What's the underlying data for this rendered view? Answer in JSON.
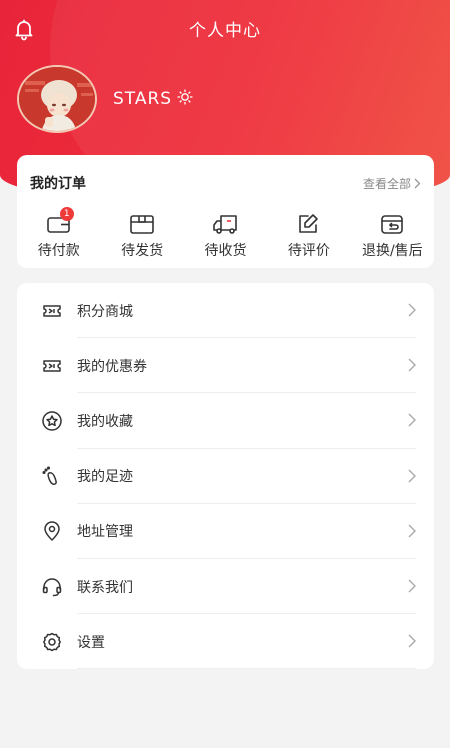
{
  "header": {
    "title": "个人中心",
    "bg_color": "#e8243a"
  },
  "profile": {
    "username": "STARS"
  },
  "orders": {
    "title": "我的订单",
    "view_all": "查看全部",
    "items": [
      {
        "label": "待付款",
        "icon": "wallet-icon",
        "badge": "1"
      },
      {
        "label": "待发货",
        "icon": "package-icon"
      },
      {
        "label": "待收货",
        "icon": "truck-icon"
      },
      {
        "label": "待评价",
        "icon": "edit-icon"
      },
      {
        "label": "退换/售后",
        "icon": "return-icon"
      }
    ]
  },
  "menu": {
    "items": [
      {
        "label": "积分商城",
        "icon": "ticket-icon"
      },
      {
        "label": "我的优惠券",
        "icon": "coupon-icon"
      },
      {
        "label": "我的收藏",
        "icon": "star-icon"
      },
      {
        "label": "我的足迹",
        "icon": "footprint-icon"
      },
      {
        "label": "地址管理",
        "icon": "location-icon"
      },
      {
        "label": "联系我们",
        "icon": "headset-icon"
      },
      {
        "label": "设置",
        "icon": "gear-icon"
      }
    ]
  }
}
